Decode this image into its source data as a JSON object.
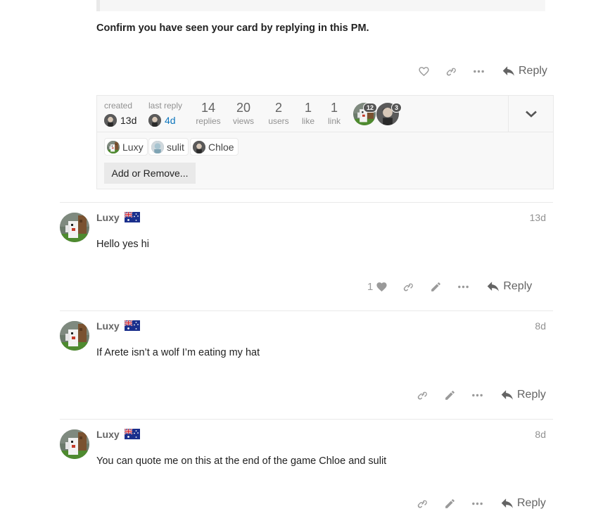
{
  "first_post": {
    "confirm_text": "Confirm you have seen your card by replying in this PM.",
    "reply_label": "Reply"
  },
  "topic_map": {
    "created_label": "created",
    "created_value": "13d",
    "last_reply_label": "last reply",
    "last_reply_value": "4d",
    "stats": [
      {
        "number": "14",
        "label": "replies"
      },
      {
        "number": "20",
        "label": "views"
      },
      {
        "number": "2",
        "label": "users"
      },
      {
        "number": "1",
        "label": "like"
      },
      {
        "number": "1",
        "label": "link"
      }
    ],
    "poster_badges": [
      "12",
      "3"
    ],
    "participants": [
      "Luxy",
      "sulit",
      "Chloe"
    ],
    "add_remove_label": "Add or Remove..."
  },
  "posts": [
    {
      "username": "Luxy",
      "date": "13d",
      "body": "Hello yes hi",
      "like_count": "1",
      "reply_label": "Reply"
    },
    {
      "username": "Luxy",
      "date": "8d",
      "body": "If Arete isn’t a wolf I’m eating my hat",
      "reply_label": "Reply"
    },
    {
      "username": "Luxy",
      "date": "8d",
      "body": "You can quote me on this at the end of the game Chloe and sulit",
      "reply_label": "Reply"
    }
  ],
  "colors": {
    "link_blue": "#0e76bd",
    "muted": "#919191",
    "border": "#e9e9e9"
  }
}
